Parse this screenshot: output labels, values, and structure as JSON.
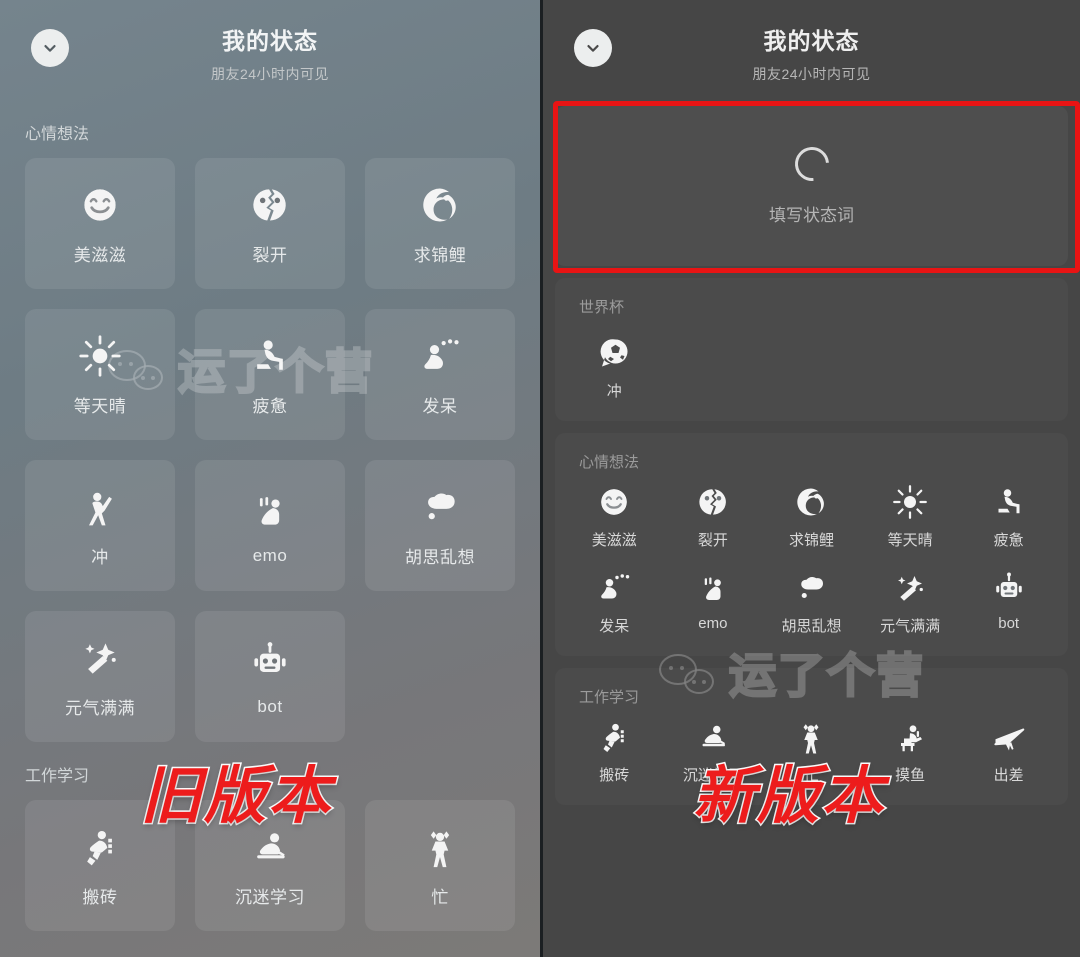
{
  "header": {
    "title": "我的状态",
    "subtitle": "朋友24小时内可见",
    "back_icon": "chevron-down-icon"
  },
  "watermark": {
    "text": "运了个营",
    "logo": "wechat-bubbles-logo"
  },
  "annotations": {
    "old_version_label": "旧版本",
    "new_version_label": "新版本",
    "highlight_color": "#e81414"
  },
  "old_version": {
    "section_label_mood": "心情想法",
    "section_label_work": "工作学习",
    "mood_items": [
      {
        "label": "美滋滋",
        "icon": "smiley-face-icon"
      },
      {
        "label": "裂开",
        "icon": "cracked-face-icon"
      },
      {
        "label": "求锦鲤",
        "icon": "koi-fish-icon"
      },
      {
        "label": "等天晴",
        "icon": "sun-icon"
      },
      {
        "label": "疲惫",
        "icon": "tired-person-icon"
      },
      {
        "label": "发呆",
        "icon": "daydream-person-icon"
      },
      {
        "label": "冲",
        "icon": "charging-person-icon"
      },
      {
        "label": "emo",
        "icon": "crouching-person-icon"
      },
      {
        "label": "胡思乱想",
        "icon": "thought-cloud-icon"
      },
      {
        "label": "元气满满",
        "icon": "magic-wand-star-icon"
      },
      {
        "label": "bot",
        "icon": "robot-icon"
      }
    ],
    "work_items": [
      {
        "label": "搬砖",
        "icon": "carrying-bricks-icon"
      },
      {
        "label": "沉迷学习",
        "icon": "studying-person-icon"
      },
      {
        "label": "忙",
        "icon": "busy-person-icon"
      }
    ]
  },
  "new_version": {
    "status_input": {
      "label": "填写状态词",
      "icon": "circle-spinner-icon"
    },
    "worldcup": {
      "label": "世界杯",
      "items": [
        {
          "label": "冲",
          "icon": "soccer-ball-bubble-icon"
        }
      ]
    },
    "mood": {
      "label": "心情想法",
      "items": [
        {
          "label": "美滋滋",
          "icon": "smiley-face-icon"
        },
        {
          "label": "裂开",
          "icon": "cracked-face-icon"
        },
        {
          "label": "求锦鲤",
          "icon": "koi-fish-icon"
        },
        {
          "label": "等天晴",
          "icon": "sun-icon"
        },
        {
          "label": "疲惫",
          "icon": "tired-person-icon"
        },
        {
          "label": "发呆",
          "icon": "daydream-person-icon"
        },
        {
          "label": "emo",
          "icon": "crouching-person-icon"
        },
        {
          "label": "胡思乱想",
          "icon": "thought-cloud-icon"
        },
        {
          "label": "元气满满",
          "icon": "magic-wand-star-icon"
        },
        {
          "label": "bot",
          "icon": "robot-icon"
        }
      ]
    },
    "work": {
      "label": "工作学习",
      "items": [
        {
          "label": "搬砖",
          "icon": "carrying-bricks-icon"
        },
        {
          "label": "沉迷学习",
          "icon": "studying-person-icon"
        },
        {
          "label": "忙",
          "icon": "busy-person-icon"
        },
        {
          "label": "摸鱼",
          "icon": "slacking-person-icon"
        },
        {
          "label": "出差",
          "icon": "airplane-icon"
        }
      ]
    }
  }
}
